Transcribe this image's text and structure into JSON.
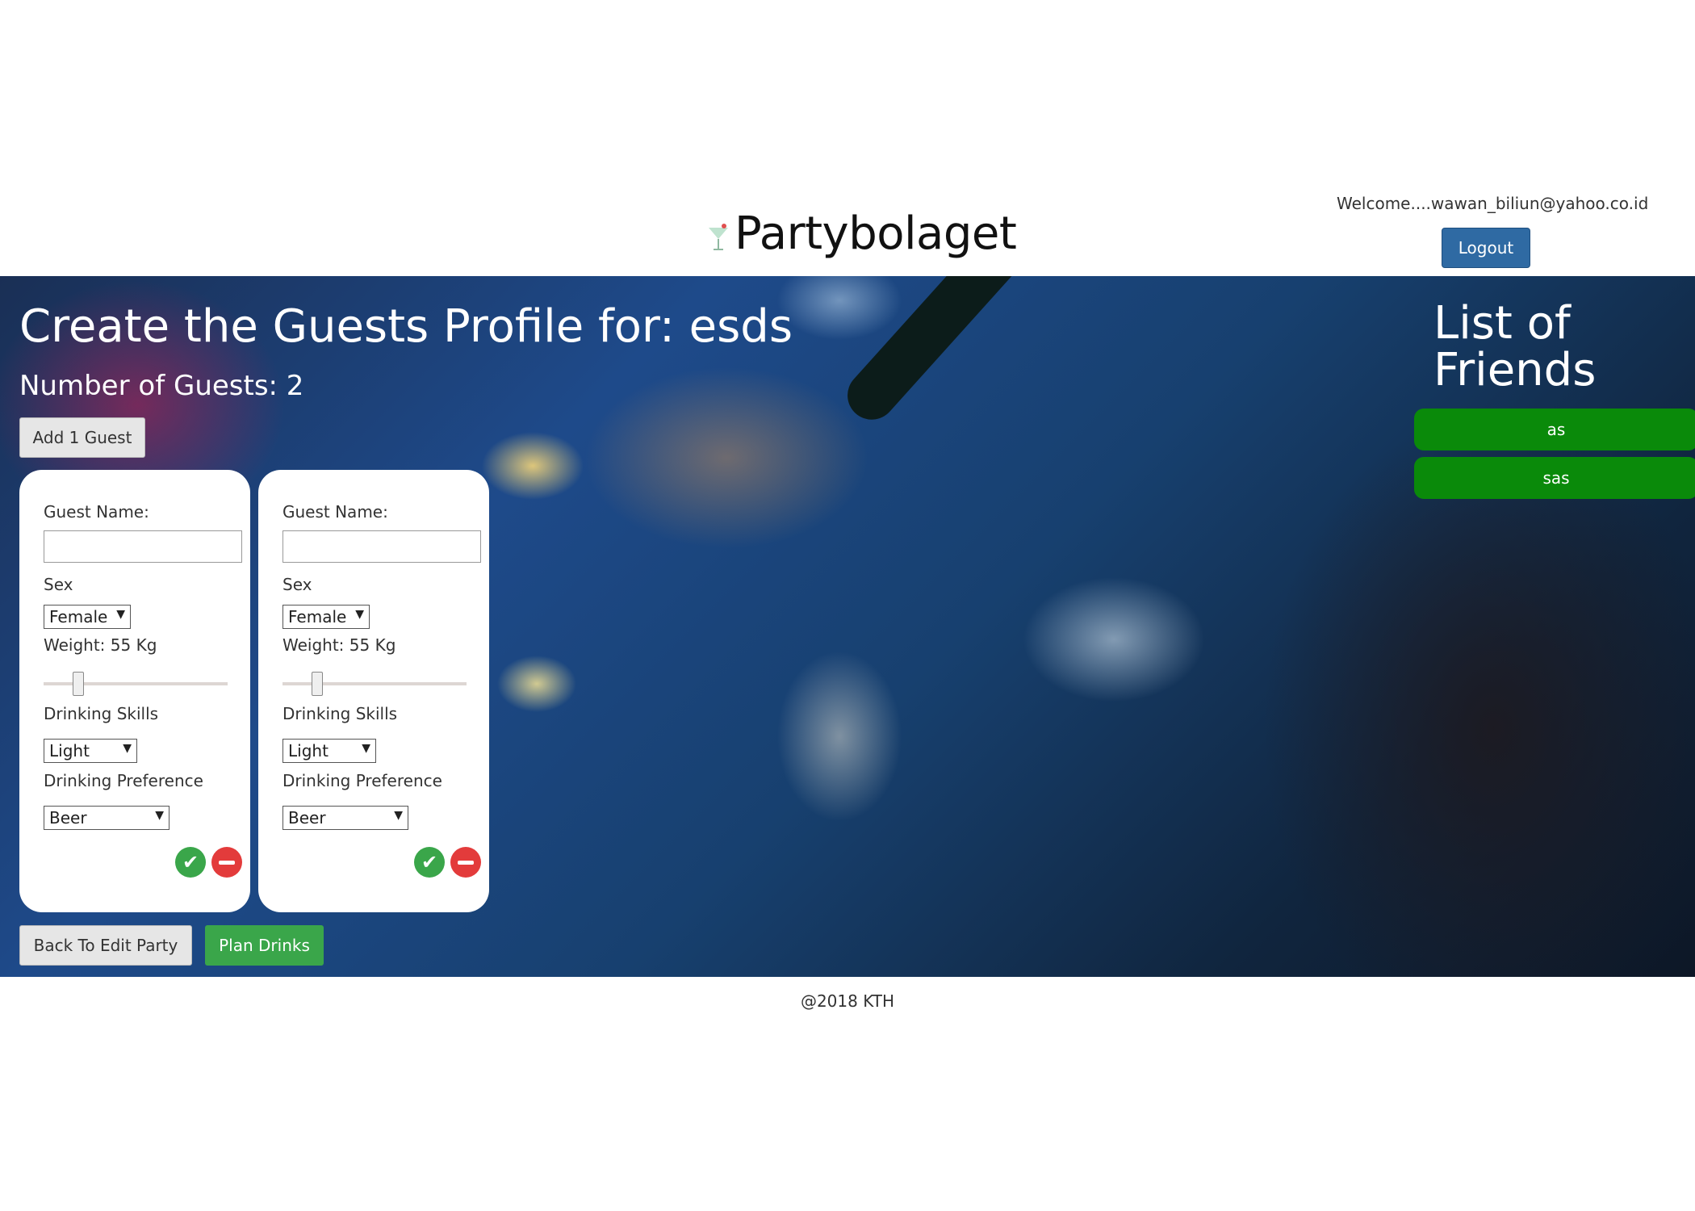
{
  "header": {
    "brand": "Partybolaget",
    "brand_icon": "cocktail-glass-icon",
    "welcome": "Welcome....wawan_biliun@yahoo.co.id",
    "logout_label": "Logout"
  },
  "main": {
    "title": "Create the Guests Profile for: esds",
    "guest_count": "Number of Guests: 2",
    "add_guest_label": "Add 1 Guest",
    "guests": [
      {
        "name_label": "Guest Name:",
        "name_value": "",
        "sex_label": "Sex",
        "sex_value": "Female",
        "weight_label": "Weight: 55 Kg",
        "weight_kg": 55,
        "skills_label": "Drinking Skills",
        "skills_value": "Light",
        "preference_label": "Drinking Preference",
        "preference_value": "Beer"
      },
      {
        "name_label": "Guest Name:",
        "name_value": "",
        "sex_label": "Sex",
        "sex_value": "Female",
        "weight_label": "Weight: 55 Kg",
        "weight_kg": 55,
        "skills_label": "Drinking Skills",
        "skills_value": "Light",
        "preference_label": "Drinking Preference",
        "preference_value": "Beer"
      }
    ],
    "back_label": "Back To Edit Party",
    "plan_label": "Plan Drinks"
  },
  "friends": {
    "title": "List of Friends",
    "items": [
      "as",
      "sas"
    ]
  },
  "footer": {
    "text": "@2018 KTH"
  },
  "colors": {
    "primary_button": "#2f6aa3",
    "success": "#3aa64a",
    "danger": "#e33b3b",
    "friend_item": "#0a8a0a"
  }
}
